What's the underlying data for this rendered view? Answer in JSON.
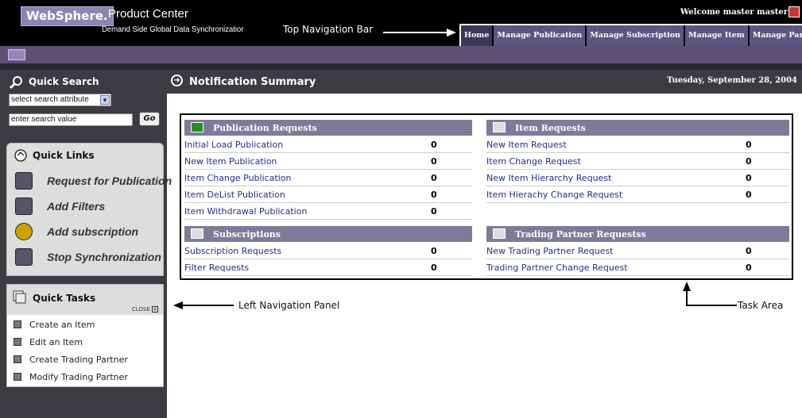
{
  "header": {
    "logo": "WebSphere.",
    "product": "Product Center",
    "subtitle": "Demand Side Global Data Synchronizatior",
    "welcome": "Welcome master master"
  },
  "nav": {
    "callout": "Top Navigation Bar",
    "tabs": [
      "Home",
      "Manage Publication",
      "Manage Subscription",
      "Manage Item",
      "Manage Partner"
    ]
  },
  "quick_search": {
    "title": "Quick Search",
    "select_value": "select search attribute",
    "input_value": "enter search value",
    "go": "Go"
  },
  "quick_links": {
    "title": "Quick Links",
    "items": [
      "Request for Publication",
      "Add Filters",
      "Add subscription",
      "Stop Synchronization"
    ]
  },
  "quick_tasks": {
    "title": "Quick Tasks",
    "close": "CLOSE",
    "items": [
      "Create an Item",
      "Edit an Item",
      "Create Trading Partner",
      "Modify Trading Partner"
    ]
  },
  "left_callout": "Left Navigation Panel",
  "page": {
    "title": "Notification Summary",
    "date": "Tuesday, September 28, 2004"
  },
  "pub": {
    "title": "Publication Requests",
    "rows": [
      [
        "Initial Load Publication",
        "0"
      ],
      [
        "New Item Publication",
        "0"
      ],
      [
        "Item Change Publication",
        "0"
      ],
      [
        "Item DeList Publication",
        "0"
      ],
      [
        "Item Withdrawal Publication",
        "0"
      ]
    ]
  },
  "item": {
    "title": "Item Requests",
    "rows": [
      [
        "New Item Request",
        "0"
      ],
      [
        "Item Change Request",
        "0"
      ],
      [
        "New Item Hierarchy Request",
        "0"
      ],
      [
        "Item Hierachy Change Request",
        "0"
      ]
    ]
  },
  "subs": {
    "title": "Subscriptions",
    "rows": [
      [
        "Subscription Requests",
        "0"
      ],
      [
        "Filter Requests",
        "0"
      ]
    ]
  },
  "tp": {
    "title": "Trading Partner Requestss",
    "rows": [
      [
        "New Trading Partner Request",
        "0"
      ],
      [
        "Trading Partner Change Request",
        "0"
      ]
    ]
  },
  "task_callout": "Task Area"
}
